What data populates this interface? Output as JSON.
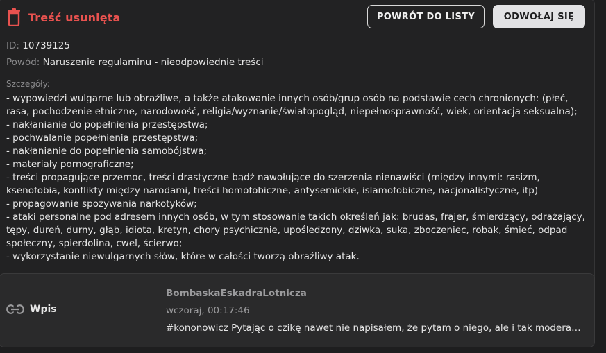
{
  "header": {
    "title": "Treść usunięta",
    "back_button": "POWRÓT DO LISTY",
    "appeal_button": "ODWOŁAJ SIĘ"
  },
  "meta": {
    "id_label": "ID:",
    "id_value": "10739125",
    "reason_label": "Powód:",
    "reason_value": "Naruszenie regulaminu - nieodpowiednie treści"
  },
  "details": {
    "label": "Szczegóły:",
    "text": "- wypowiedzi wulgarne lub obraźliwe, a także atakowanie innych osób/grup osób na podstawie cech chronionych: (płeć, rasa, pochodzenie etniczne, narodowość, religia/wyznanie/światopogląd, niepełnosprawność, wiek, orientacja seksualna);\n- nakłanianie do popełnienia przestępstwa;\n- pochwalanie popełnienia przestępstwa;\n- nakłanianie do popełnienia samobójstwa;\n- materiały pornograficzne;\n- treści propagujące przemoc, treści drastyczne bądź nawołujące do szerzenia nienawiści (między innymi: rasizm, ksenofobia, konflikty między narodami, treści homofobiczne, antysemickie, islamofobiczne, nacjonalistyczne, itp)\n- propagowanie spożywania narkotyków;\n- ataki personalne pod adresem innych osób, w tym stosowanie takich określeń jak: brudas, frajer, śmierdzący, odrażający, tępy, dureń, durny, głąb, idiota, kretyn, chory psychicznie, upośledzony, dziwka, suka, zboczeniec, robak, śmieć, odpad społeczny, spierdolina, cwel, ścierwo;\n- wykorzystanie niewulgarnych słów, które w całości tworzą obraźliwy atak."
  },
  "card": {
    "type_label": "Wpis",
    "author": "BombaskaEskadraLotnicza",
    "time": "wczoraj, 00:17:46",
    "excerpt": "#kononowicz Pytając o czikę nawet nie napisałem, że pytam o niego, ale i tak moderacja ..."
  },
  "icons": {
    "title_icon": "trash-icon",
    "type_icon": "link-icon"
  },
  "colors": {
    "accent_red": "#e8524f",
    "background": "#1e1e1f",
    "panel": "#222223",
    "card": "#2a2a2b"
  }
}
